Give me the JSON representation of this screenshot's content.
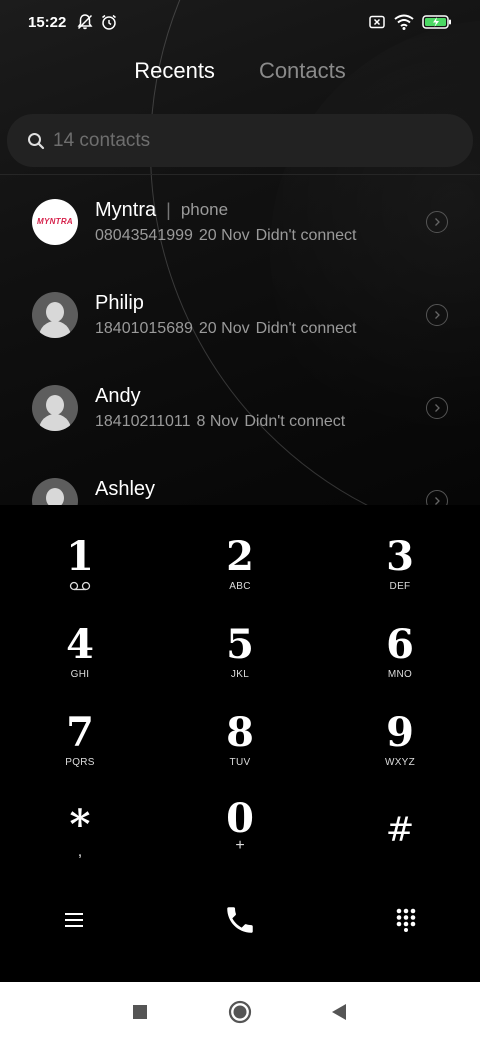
{
  "status_bar": {
    "time": "15:22",
    "left_icons": [
      "notifications-off-icon",
      "alarm-icon"
    ],
    "right_icons": [
      "sim-off-icon",
      "wifi-icon",
      "battery-charging-icon"
    ],
    "battery_color": "#4cd964"
  },
  "tabs": [
    {
      "label": "Recents",
      "active": true
    },
    {
      "label": "Contacts",
      "active": false
    }
  ],
  "search": {
    "placeholder": "14 contacts",
    "icon": "search-icon"
  },
  "recents": [
    {
      "name": "Myntra",
      "type": "phone",
      "number": "08043541999",
      "date": "20 Nov",
      "status": "Didn't connect",
      "avatar": "myntra-logo",
      "logo_text": "MYNTRA"
    },
    {
      "name": "Philip",
      "type": "",
      "number": "18401015689",
      "date": "20 Nov",
      "status": "Didn't connect",
      "avatar": "person"
    },
    {
      "name": "Andy",
      "type": "",
      "number": "18410211011",
      "date": "8 Nov",
      "status": "Didn't connect",
      "avatar": "person"
    },
    {
      "name": "Ashley",
      "type": "",
      "number": "",
      "date": "",
      "status": "",
      "avatar": "person"
    }
  ],
  "dialpad": {
    "keys": [
      {
        "digit": "1",
        "letters": "voicemail-icon"
      },
      {
        "digit": "2",
        "letters": "ABC"
      },
      {
        "digit": "3",
        "letters": "DEF"
      },
      {
        "digit": "4",
        "letters": "GHI"
      },
      {
        "digit": "5",
        "letters": "JKL"
      },
      {
        "digit": "6",
        "letters": "MNO"
      },
      {
        "digit": "7",
        "letters": "PQRS"
      },
      {
        "digit": "8",
        "letters": "TUV"
      },
      {
        "digit": "9",
        "letters": "WXYZ"
      },
      {
        "digit": "*",
        "letters": ","
      },
      {
        "digit": "0",
        "letters": "+"
      },
      {
        "digit": "#",
        "letters": ""
      }
    ],
    "actions": [
      "menu-icon",
      "call-icon",
      "dialpad-toggle-icon"
    ]
  },
  "nav_bar": [
    "recents-square-icon",
    "home-circle-icon",
    "back-triangle-icon"
  ]
}
